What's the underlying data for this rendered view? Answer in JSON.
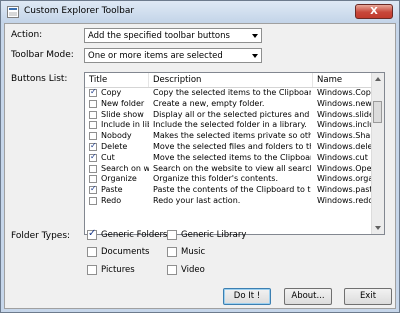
{
  "window": {
    "title": "Custom Explorer Toolbar",
    "close_label": "X"
  },
  "action": {
    "label": "Action:",
    "value": "Add the specified toolbar buttons"
  },
  "toolbar_mode": {
    "label": "Toolbar Mode:",
    "value": "One or more items are selected"
  },
  "buttons_list": {
    "label": "Buttons List:",
    "columns": [
      "Title",
      "Description",
      "Name"
    ],
    "rows": [
      {
        "checked": true,
        "title": "Copy",
        "description": "Copy the selected items to the Clipboard.",
        "name": "Windows.Copy"
      },
      {
        "checked": false,
        "title": "New folder",
        "description": "Create a new, empty folder.",
        "name": "Windows.newfol"
      },
      {
        "checked": false,
        "title": "Slide show",
        "description": "Display all or the selected pictures and videos in...",
        "name": "Windows.slidesh"
      },
      {
        "checked": false,
        "title": "Include in libr...",
        "description": "Include the selected folder in a library.",
        "name": "Windows.include"
      },
      {
        "checked": false,
        "title": "Nobody",
        "description": "Makes the selected items private so other peopl...",
        "name": "Windows.Share"
      },
      {
        "checked": true,
        "title": "Delete",
        "description": "Move the selected files and folders to the Recy...",
        "name": "Windows.delete"
      },
      {
        "checked": true,
        "title": "Cut",
        "description": "Move the selected items to the Clipboard.",
        "name": "Windows.cut"
      },
      {
        "checked": false,
        "title": "Search on w...",
        "description": "Search on the website to view all search results.",
        "name": "Windows.OpenS"
      },
      {
        "checked": false,
        "title": "Organize",
        "description": "Organize this folder's contents.",
        "name": "Windows.organiz"
      },
      {
        "checked": true,
        "title": "Paste",
        "description": "Paste the contents of the Clipboard to the curr...",
        "name": "Windows.paste"
      },
      {
        "checked": false,
        "title": "Redo",
        "description": "Redo your last action.",
        "name": "Windows.redo"
      }
    ]
  },
  "folder_types": {
    "label": "Folder Types:",
    "options": [
      {
        "label": "Generic Folders",
        "checked": true
      },
      {
        "label": "Generic Library",
        "checked": false
      },
      {
        "label": "Documents",
        "checked": false
      },
      {
        "label": "Music",
        "checked": false
      },
      {
        "label": "Pictures",
        "checked": false
      },
      {
        "label": "Video",
        "checked": false
      }
    ]
  },
  "buttons": {
    "doit": "Do It !",
    "about": "About...",
    "exit": "Exit"
  },
  "colors": {
    "titlebar": "#c3d4e8",
    "close": "#c8473a",
    "client": "#f0f0f0",
    "check": "#1b3b8c"
  }
}
